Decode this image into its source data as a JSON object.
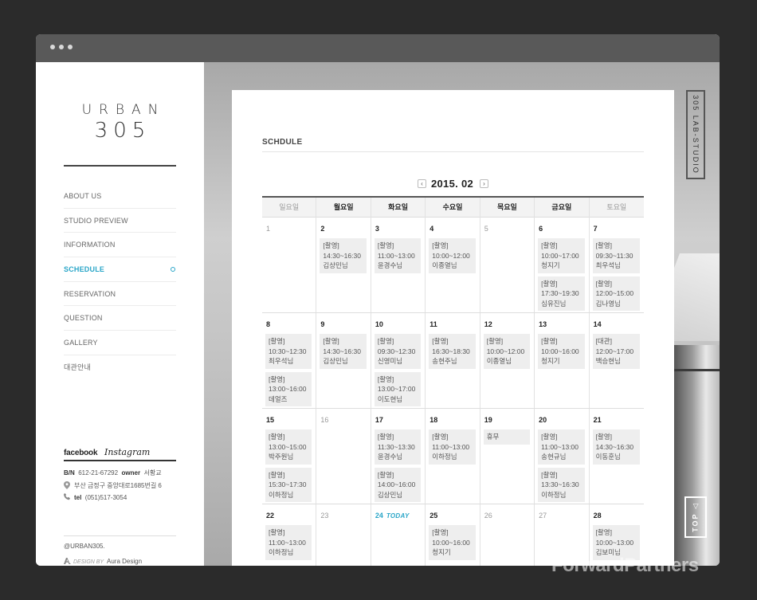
{
  "site": {
    "logo_word": "URBAN",
    "logo_num": "305"
  },
  "menu": [
    {
      "label": "ABOUT US",
      "active": false
    },
    {
      "label": "STUDIO PREVIEW",
      "active": false
    },
    {
      "label": "INFORMATION",
      "active": false
    },
    {
      "label": "SCHEDULE",
      "active": true
    },
    {
      "label": "RESERVATION",
      "active": false
    },
    {
      "label": "QUESTION",
      "active": false
    },
    {
      "label": "GALLERY",
      "active": false
    },
    {
      "label": "대관안내",
      "active": false
    }
  ],
  "social": {
    "facebook": "facebook",
    "instagram": "Instagram"
  },
  "footer": {
    "bn_label": "B/N",
    "bn_value": "612-21-67292",
    "owner_label": "owner",
    "owner_value": "서황교",
    "address": "부산 금정구 중앙대로1685번길 6",
    "tel_label": "tel",
    "tel_value": "(051)517-3054",
    "copyright": "@URBAN305.",
    "design_by": "DESIGN BY",
    "designer": "Aura Design"
  },
  "schedule": {
    "title": "SCHDULE",
    "month": "2015. 02",
    "prev_icon": "‹",
    "next_icon": "›",
    "weekdays": [
      {
        "label": "일요일",
        "muted": true
      },
      {
        "label": "월요일",
        "muted": false
      },
      {
        "label": "화요일",
        "muted": false
      },
      {
        "label": "수요일",
        "muted": false
      },
      {
        "label": "목요일",
        "muted": false
      },
      {
        "label": "금요일",
        "muted": false
      },
      {
        "label": "토요일",
        "muted": true
      }
    ],
    "today_tag": "TODAY",
    "weeks": [
      [
        {
          "day": "1",
          "gray": true,
          "events": []
        },
        {
          "day": "2",
          "events": [
            [
              "[촬영]",
              "14:30~16:30",
              "김상민님"
            ]
          ]
        },
        {
          "day": "3",
          "events": [
            [
              "[촬영]",
              "11:00~13:00",
              "윤경수님"
            ]
          ]
        },
        {
          "day": "4",
          "events": [
            [
              "[촬영]",
              "10:00~12:00",
              "이종열님"
            ]
          ]
        },
        {
          "day": "5",
          "gray": true,
          "events": []
        },
        {
          "day": "6",
          "events": [
            [
              "[촬영]",
              "10:00~17:00",
              "청지기"
            ],
            [
              "[촬영]",
              "17:30~19:30",
              "심유진님"
            ]
          ]
        },
        {
          "day": "7",
          "events": [
            [
              "[촬영]",
              "09:30~11:30",
              "최우석님"
            ],
            [
              "[촬영]",
              "12:00~15:00",
              "김나영님"
            ]
          ]
        }
      ],
      [
        {
          "day": "8",
          "events": [
            [
              "[촬영]",
              "10:30~12:30",
              "최우석님"
            ],
            [
              "[촬영]",
              "13:00~16:00",
              "데얼즈"
            ]
          ]
        },
        {
          "day": "9",
          "events": [
            [
              "[촬영]",
              "14:30~16:30",
              "김상민님"
            ]
          ]
        },
        {
          "day": "10",
          "events": [
            [
              "[촬영]",
              "09:30~12:30",
              "신영미님"
            ],
            [
              "[촬영]",
              "13:00~17:00",
              "이도현님"
            ]
          ]
        },
        {
          "day": "11",
          "events": [
            [
              "[촬영]",
              "16:30~18:30",
              "송현주님"
            ]
          ]
        },
        {
          "day": "12",
          "events": [
            [
              "[촬영]",
              "10:00~12:00",
              "이종열님"
            ]
          ]
        },
        {
          "day": "13",
          "events": [
            [
              "[촬영]",
              "10:00~16:00",
              "청지기"
            ]
          ]
        },
        {
          "day": "14",
          "events": [
            [
              "[대관]",
              "12:00~17:00",
              "백승현님"
            ]
          ]
        }
      ],
      [
        {
          "day": "15",
          "events": [
            [
              "[촬영]",
              "13:00~15:00",
              "박주원님"
            ],
            [
              "[촬영]",
              "15:30~17:30",
              "이하정님"
            ]
          ]
        },
        {
          "day": "16",
          "gray": true,
          "events": []
        },
        {
          "day": "17",
          "events": [
            [
              "[촬영]",
              "11:30~13:30",
              "윤경수님"
            ],
            [
              "[촬영]",
              "14:00~16:00",
              "김상민님"
            ]
          ]
        },
        {
          "day": "18",
          "events": [
            [
              "[촬영]",
              "11:00~13:00",
              "이하정님"
            ]
          ]
        },
        {
          "day": "19",
          "events": [
            [
              "휴무"
            ]
          ]
        },
        {
          "day": "20",
          "events": [
            [
              "[촬영]",
              "11:00~13:00",
              "송현규님"
            ],
            [
              "[촬영]",
              "13:30~16:30",
              "이하정님"
            ]
          ]
        },
        {
          "day": "21",
          "events": [
            [
              "[촬영]",
              "14:30~16:30",
              "이동훈님"
            ]
          ]
        }
      ],
      [
        {
          "day": "22",
          "events": [
            [
              "[촬영]",
              "11:00~13:00",
              "이하정님"
            ]
          ]
        },
        {
          "day": "23",
          "gray": true,
          "events": []
        },
        {
          "day": "24",
          "today": true,
          "events": []
        },
        {
          "day": "25",
          "events": [
            [
              "[촬영]",
              "10:00~16:00",
              "청지기"
            ]
          ]
        },
        {
          "day": "26",
          "gray": true,
          "events": []
        },
        {
          "day": "27",
          "gray": true,
          "events": []
        },
        {
          "day": "28",
          "events": [
            [
              "[촬영]",
              "10:00~13:00",
              "김보미님"
            ]
          ]
        }
      ]
    ]
  },
  "side_label": "305 LAB-STUDIO",
  "top_button": "TOP ◁",
  "watermark": "ForwardPartners"
}
